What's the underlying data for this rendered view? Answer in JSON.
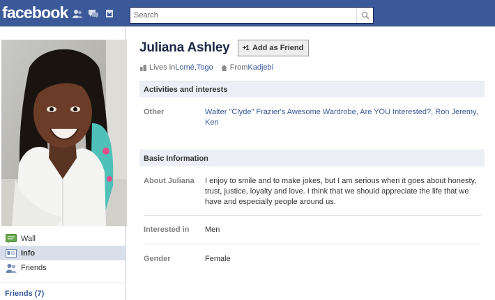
{
  "topbar": {
    "logo": "facebook",
    "jewels": [
      "friend-requests-icon",
      "messages-icon",
      "notifications-icon"
    ],
    "search": {
      "value": "",
      "placeholder": "Search"
    }
  },
  "sidebar": {
    "items": [
      {
        "label": "Wall",
        "icon": "wall-icon",
        "active": false
      },
      {
        "label": "Info",
        "icon": "info-icon",
        "active": true
      },
      {
        "label": "Friends",
        "icon": "friends-icon",
        "active": false
      }
    ],
    "friends_link": "Friends (7)"
  },
  "profile": {
    "name": "Juliana Ashley",
    "add_friend_label": "Add as Friend",
    "lives_prefix": "Lives in ",
    "lives_city": "Lomé",
    "lives_sep": ", ",
    "lives_country": "Togo",
    "from_prefix": "From ",
    "from_place": "Kadjebi"
  },
  "sections": {
    "activities": {
      "title": "Activities and interests",
      "other_label": "Other",
      "other_value": "Walter \"Clyde\" Frazier's Awesome Wardrobe, Are YOU Interested?, Ron Jeremy, Ken"
    },
    "basic": {
      "title": "Basic Information",
      "about_label": "About Juliana",
      "about_value": "I enjoy to smile and to make jokes, but I am serious when it goes about honesty, trust, justice, loyalty and love. I think that we should appreciate the life that we have and especially people around us.",
      "interested_label": "Interested in",
      "interested_value": "Men",
      "gender_label": "Gender",
      "gender_value": "Female"
    }
  },
  "colors": {
    "brand": "#3b5998",
    "link": "#3b5998",
    "section_bg": "#eceff5",
    "active_nav": "#d8dfea"
  }
}
